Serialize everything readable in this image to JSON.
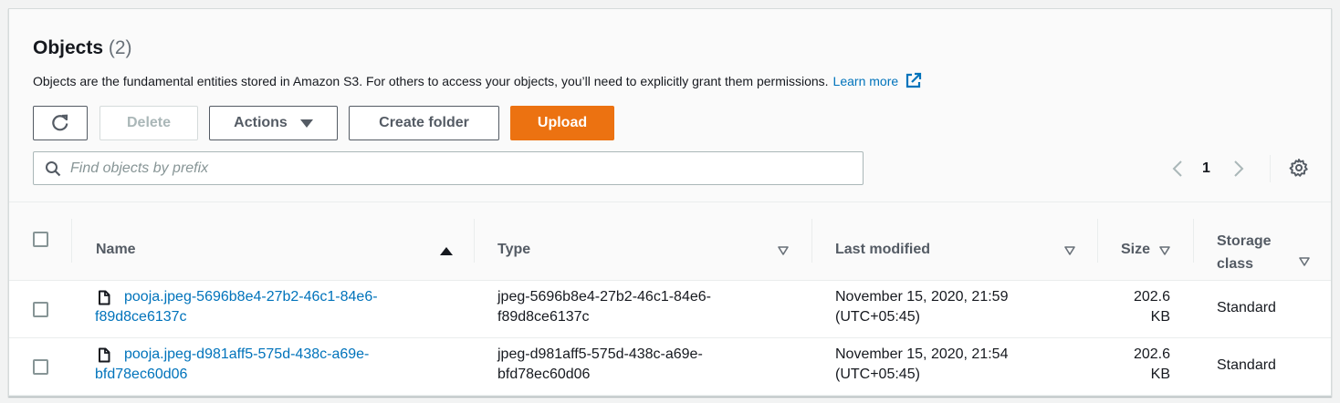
{
  "header": {
    "title": "Objects",
    "count": "(2)",
    "description": "Objects are the fundamental entities stored in Amazon S3. For others to access your objects, you’ll need to explicitly grant them permissions.",
    "learn_more": "Learn more"
  },
  "toolbar": {
    "refresh_icon": "refresh-icon",
    "delete_label": "Delete",
    "actions_label": "Actions",
    "create_folder_label": "Create folder",
    "upload_label": "Upload"
  },
  "search": {
    "placeholder": "Find objects by prefix",
    "value": ""
  },
  "pagination": {
    "current_page": "1"
  },
  "table": {
    "columns": [
      "Name",
      "Type",
      "Last modified",
      "Size",
      "Storage class"
    ],
    "size_header": "Size",
    "storage_header_line1": "Storage",
    "storage_header_line2": "class",
    "rows": [
      {
        "name_line1": "pooja.jpeg-5696b8e4-27b2-46c1-84e6-",
        "name_line2": "f89d8ce6137c",
        "type_line1": "jpeg-5696b8e4-27b2-46c1-84e6-",
        "type_line2": "f89d8ce6137c",
        "modified_line1": "November 15, 2020, 21:59",
        "modified_line2": "(UTC+05:45)",
        "size_line1": "202.6",
        "size_line2": "KB",
        "storage_class": "Standard"
      },
      {
        "name_line1": "pooja.jpeg-d981aff5-575d-438c-a69e-",
        "name_line2": "bfd78ec60d06",
        "type_line1": "jpeg-d981aff5-575d-438c-a69e-",
        "type_line2": "bfd78ec60d06",
        "modified_line1": "November 15, 2020, 21:54",
        "modified_line2": "(UTC+05:45)",
        "size_line1": "202.6",
        "size_line2": "KB",
        "storage_class": "Standard"
      }
    ]
  },
  "colors": {
    "accent_orange": "#ec7211",
    "link_blue": "#0073bb",
    "border_gray": "#545b64"
  }
}
